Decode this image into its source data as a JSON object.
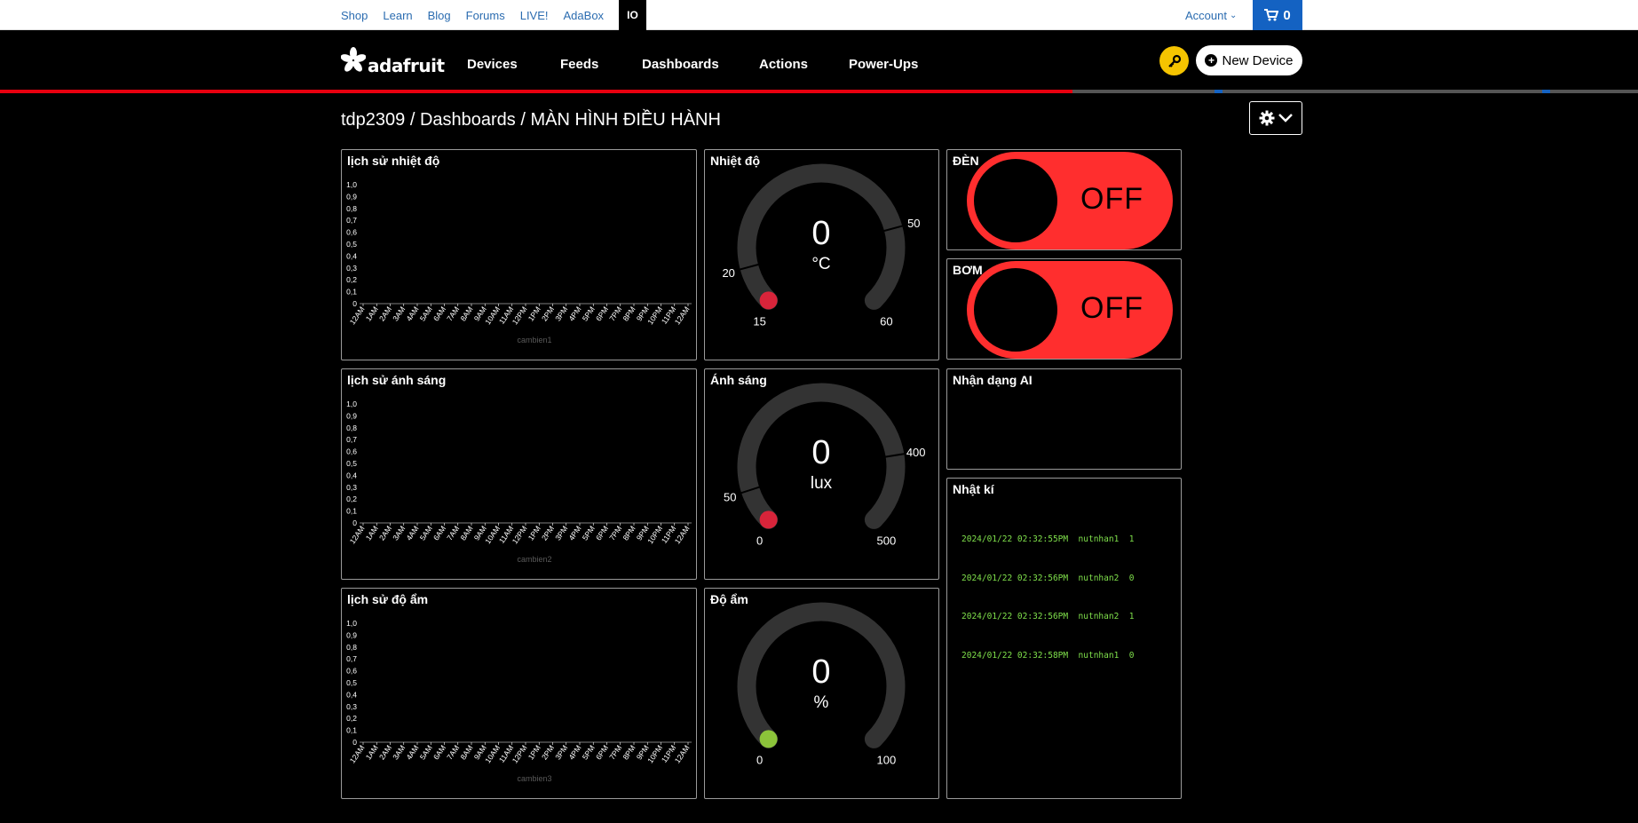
{
  "topbar": {
    "links": [
      "Shop",
      "Learn",
      "Blog",
      "Forums",
      "LIVE!",
      "AdaBox"
    ],
    "io_label": "IO",
    "account_label": "Account",
    "cart_count": "0"
  },
  "header": {
    "logo_text": "adafruit",
    "nav": [
      "Devices",
      "Feeds",
      "Dashboards",
      "Actions",
      "Power-Ups"
    ],
    "new_device_label": "New Device"
  },
  "breadcrumb": "tdp2309 / Dashboards / MÀN HÌNH ĐIỀU HÀNH",
  "colors": {
    "accent_red": "#ff2e2e",
    "gauge_track": "#333333",
    "gauge_dot_red": "#d8243a",
    "gauge_dot_green": "#8cc43a",
    "log_green": "#7fe04b",
    "brand_blue": "#1462c2",
    "key_yellow": "#f5c400"
  },
  "charts": [
    {
      "title": "lịch sử nhiệt độ",
      "feed": "cambien1"
    },
    {
      "title": "lịch sử ánh sáng",
      "feed": "cambien2"
    },
    {
      "title": "lịch sử độ ẩm",
      "feed": "cambien3"
    }
  ],
  "chart_data": [
    {
      "type": "line",
      "title": "lịch sử nhiệt độ",
      "xlabel": "cambien1",
      "ylabel": "",
      "ylim": [
        0,
        1
      ],
      "y_ticks": [
        "1,0",
        "0,9",
        "0,8",
        "0,7",
        "0,6",
        "0,5",
        "0,4",
        "0,3",
        "0,2",
        "0,1",
        "0"
      ],
      "x_ticks": [
        "12AM",
        "1AM",
        "2AM",
        "3AM",
        "4AM",
        "5AM",
        "6AM",
        "7AM",
        "8AM",
        "9AM",
        "10AM",
        "11AM",
        "12PM",
        "1PM",
        "2PM",
        "3PM",
        "4PM",
        "5PM",
        "6PM",
        "7PM",
        "8PM",
        "9PM",
        "10PM",
        "11PM",
        "12AM"
      ],
      "series": [
        {
          "values": []
        }
      ]
    },
    {
      "type": "line",
      "title": "lịch sử ánh sáng",
      "xlabel": "cambien2",
      "ylabel": "",
      "ylim": [
        0,
        1
      ],
      "y_ticks": [
        "1,0",
        "0,9",
        "0,8",
        "0,7",
        "0,6",
        "0,5",
        "0,4",
        "0,3",
        "0,2",
        "0,1",
        "0"
      ],
      "x_ticks": [
        "12AM",
        "1AM",
        "2AM",
        "3AM",
        "4AM",
        "5AM",
        "6AM",
        "7AM",
        "8AM",
        "9AM",
        "10AM",
        "11AM",
        "12PM",
        "1PM",
        "2PM",
        "3PM",
        "4PM",
        "5PM",
        "6PM",
        "7PM",
        "8PM",
        "9PM",
        "10PM",
        "11PM",
        "12AM"
      ],
      "series": [
        {
          "values": []
        }
      ]
    },
    {
      "type": "line",
      "title": "lịch sử độ ẩm",
      "xlabel": "cambien3",
      "ylabel": "",
      "ylim": [
        0,
        1
      ],
      "y_ticks": [
        "1,0",
        "0,9",
        "0,8",
        "0,7",
        "0,6",
        "0,5",
        "0,4",
        "0,3",
        "0,2",
        "0,1",
        "0"
      ],
      "x_ticks": [
        "12AM",
        "1AM",
        "2AM",
        "3AM",
        "4AM",
        "5AM",
        "6AM",
        "7AM",
        "8AM",
        "9AM",
        "10AM",
        "11AM",
        "12PM",
        "1PM",
        "2PM",
        "3PM",
        "4PM",
        "5PM",
        "6PM",
        "7PM",
        "8PM",
        "9PM",
        "10PM",
        "11PM",
        "12AM"
      ],
      "series": [
        {
          "values": []
        }
      ]
    }
  ],
  "gauges": [
    {
      "title": "Nhiệt độ",
      "value": "0",
      "unit": "°C",
      "min": "15",
      "max": "60",
      "low": "20",
      "high": "50",
      "min_v": 15,
      "max_v": 60,
      "low_v": 20,
      "high_v": 50,
      "dot": "red"
    },
    {
      "title": "Ánh sáng",
      "value": "0",
      "unit": "lux",
      "min": "0",
      "max": "500",
      "low": "50",
      "high": "400",
      "min_v": 0,
      "max_v": 500,
      "low_v": 50,
      "high_v": 400,
      "dot": "red"
    },
    {
      "title": "Độ ẩm",
      "value": "0",
      "unit": "%",
      "min": "0",
      "max": "100",
      "min_v": 0,
      "max_v": 100,
      "dot": "green"
    }
  ],
  "toggles": [
    {
      "title": "ĐÈN",
      "state": "OFF"
    },
    {
      "title": "BƠM",
      "state": "OFF"
    }
  ],
  "ai_panel": {
    "title": "Nhận dạng AI"
  },
  "log_panel": {
    "title": "Nhật kí",
    "lines": [
      "2024/01/22 02:32:55PM  nutnhan1  1",
      "2024/01/22 02:32:56PM  nutnhan2  0",
      "2024/01/22 02:32:56PM  nutnhan2  1",
      "2024/01/22 02:32:58PM  nutnhan1  0"
    ]
  }
}
